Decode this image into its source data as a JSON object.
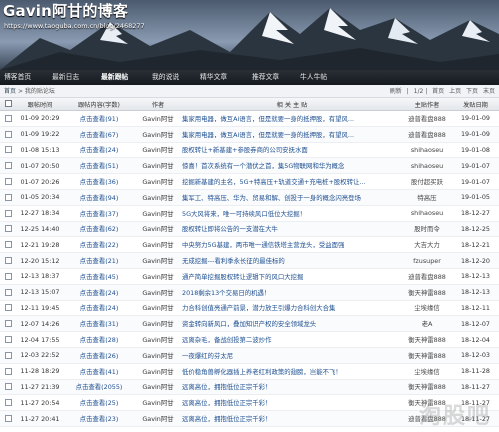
{
  "header": {
    "title": "Gavin阿甘的博客",
    "url": "https://www.taoguba.com.cn/blog/2468277"
  },
  "nav": {
    "items": [
      {
        "label": "博客首页",
        "active": false
      },
      {
        "label": "最新日志",
        "active": false
      },
      {
        "label": "最新跟帖",
        "active": true
      },
      {
        "label": "我的说说",
        "active": false
      },
      {
        "label": "精华文章",
        "active": false
      },
      {
        "label": "推荐文章",
        "active": false
      },
      {
        "label": "牛人牛帖",
        "active": false
      }
    ]
  },
  "breadcrumb": {
    "home": "首页",
    "separator": ">",
    "current": "我的贴论坛"
  },
  "pager": {
    "refresh": "刷新",
    "page": "1/2",
    "first": "首页",
    "prev": "上页",
    "next": "下页",
    "last": "末页"
  },
  "table": {
    "headers": {
      "date": "跟帖时间",
      "views": "跟帖内容(字数)",
      "author": "作者",
      "title": "相 关 主 贴",
      "by": "主贴作者",
      "time": "发贴日期"
    },
    "rows": [
      {
        "date": "01-09 20:29",
        "views": "点击查看(91)",
        "author": "Gavin阿甘",
        "title": "集家用电器，做互Ai语言，但是就要一身的抵押股，有望风...",
        "by": "迪普看盘888",
        "time": "19-01-09"
      },
      {
        "date": "01-09 19:22",
        "views": "点击查看(67)",
        "author": "Gavin阿甘",
        "title": "集家用电器，做互Ai语言，但是就要一身的抵押股，有望风...",
        "by": "迪普看盘888",
        "time": "19-01-09"
      },
      {
        "date": "01-08 15:13",
        "views": "点击查看(24)",
        "author": "Gavin阿甘",
        "title": "股权转让+新基建+参股券商的公司安抚水面",
        "by": "shihaoseu",
        "time": "19-01-08"
      },
      {
        "date": "01-07 20:50",
        "views": "点击查看(51)",
        "author": "Gavin阿甘",
        "title": "惊喜！首次系统有一个潜伏之首，集5G物联网和华为概念",
        "by": "shihaoseu",
        "time": "19-01-07"
      },
      {
        "date": "01-07 20:26",
        "views": "点击查看(36)",
        "author": "Gavin阿甘",
        "title": "挖掘新基建的主名，5G+特高压+轨道交通+充电桩+股权转让...",
        "by": "股付超买跃",
        "time": "19-01-07"
      },
      {
        "date": "01-05 20:34",
        "views": "点击查看(94)",
        "author": "Gavin阿甘",
        "title": "集军工、特高压、华为、贸易和解、创投于一身的概念闪亮登场",
        "by": "特高压",
        "time": "19-01-05"
      },
      {
        "date": "12-27 18:34",
        "views": "点击查看(37)",
        "author": "Gavin阿甘",
        "title": "5G大风将来，唯一可持续风口低位大挖掘！",
        "by": "shihaoseu",
        "time": "18-12-27"
      },
      {
        "date": "12-25 14:40",
        "views": "点击查看(62)",
        "author": "Gavin阿甘",
        "title": "股权转让即将公告的一支潜在大牛",
        "by": "股时而令",
        "time": "18-12-25"
      },
      {
        "date": "12-21 19:28",
        "views": "点击查看(22)",
        "author": "Gavin阿甘",
        "title": "中央努力5G基建，两市唯一通信铁塔主营龙头，受益面强",
        "by": "大吉大力",
        "time": "18-12-21"
      },
      {
        "date": "12-20 15:12",
        "views": "点击查看(21)",
        "author": "Gavin阿甘",
        "title": "无成挖掘---看利季永长征的最佳标的",
        "by": "fzusuper",
        "time": "18-12-20"
      },
      {
        "date": "12-13 18:37",
        "views": "点击查看(45)",
        "author": "Gavin阿甘",
        "title": "通产简单挖掘股权转让逻辑下的风口大挖掘",
        "by": "迪普看盘888",
        "time": "18-12-13"
      },
      {
        "date": "12-13 15:07",
        "views": "点击查看(24)",
        "author": "Gavin阿甘",
        "title": "2018剩余13个交易日的机遇！",
        "by": "衡天神雷888",
        "time": "18-12-13"
      },
      {
        "date": "12-11 19:45",
        "views": "点击查看(24)",
        "author": "Gavin阿甘",
        "title": "力合科创值亮通产前景，潜力放王引爆力合科创大合集",
        "by": "尘埃缘信",
        "time": "18-12-11"
      },
      {
        "date": "12-07 14:26",
        "views": "点击查看(31)",
        "author": "Gavin阿甘",
        "title": "资金转向新风口，叠加知识产权的安全领域龙头",
        "by": "老A",
        "time": "18-12-07"
      },
      {
        "date": "12-04 17:55",
        "views": "点击查看(28)",
        "author": "Gavin阿甘",
        "title": "远离杂毛，备战创投第二波炒作",
        "by": "衡天神雷888",
        "time": "18-12-04"
      },
      {
        "date": "12-03 22:52",
        "views": "点击查看(26)",
        "author": "Gavin阿甘",
        "title": "一夜爆红的芬太尼",
        "by": "衡天神雷888",
        "time": "18-12-03"
      },
      {
        "date": "11-28 18:29",
        "views": "点击查看(41)",
        "author": "Gavin阿甘",
        "title": "低价稳角兽孵化器插上养老红利政策的翅膀，岂能不飞！",
        "by": "尘埃缘信",
        "time": "18-11-28"
      },
      {
        "date": "11-27 21:39",
        "views": "点击查看(2055)",
        "author": "Gavin阿甘",
        "title": "远离高位，拥抱低位正宗千彩！",
        "by": "衡天神雷888",
        "time": "18-11-27"
      },
      {
        "date": "11-27 20:54",
        "views": "点击查看(25)",
        "author": "Gavin阿甘",
        "title": "远离高位，拥抱低位正宗千彩！",
        "by": "衡天神雷888",
        "time": "18-11-27"
      },
      {
        "date": "11-27 20:41",
        "views": "点击查看(23)",
        "author": "Gavin阿甘",
        "title": "远离高位，拥抱低位正宗千彩！",
        "by": "迪普看盘888",
        "time": "18-11-27"
      }
    ]
  },
  "watermark": "淘股吧"
}
